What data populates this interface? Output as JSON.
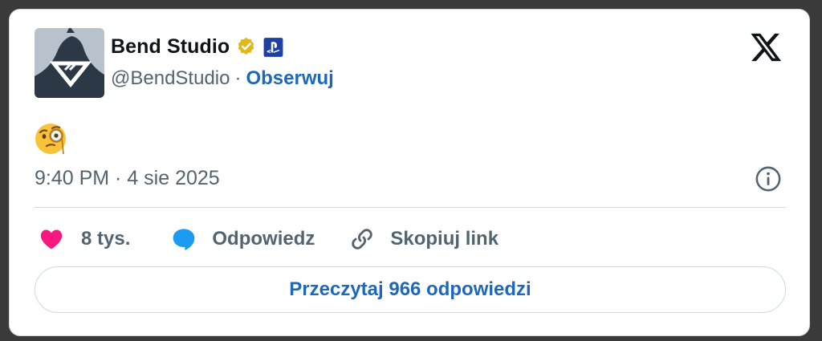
{
  "author": {
    "name": "Bend Studio",
    "handle": "@BendStudio",
    "separator": "·",
    "follow_label": "Obserwuj"
  },
  "tweet": {
    "content_emoji": "face-with-monocle",
    "timestamp": "9:40 PM · 4 sie 2025"
  },
  "actions": {
    "like_count": "8 tys.",
    "reply_label": "Odpowiedz",
    "copy_label": "Skopiuj link"
  },
  "read_replies_label": "Przeczytaj 966 odpowiedzi",
  "colors": {
    "link": "#1d68b8",
    "like": "#f91880",
    "reply": "#1d9bf0",
    "secondary_text": "#536471",
    "verified_gold": "#e2b719",
    "playstation_blue": "#1e3fa5"
  }
}
